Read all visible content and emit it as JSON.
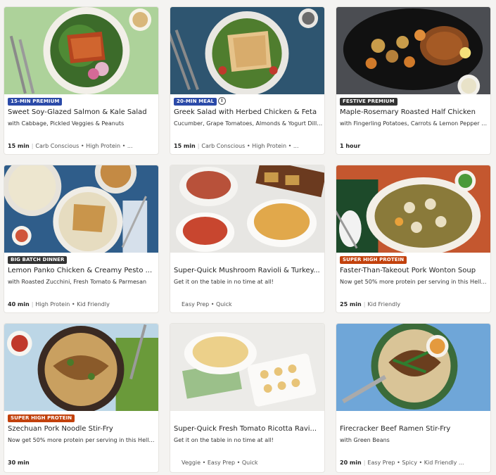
{
  "cards": [
    {
      "badge": "15-min premium",
      "badge_color": "#2b4aa8",
      "title": "Sweet Soy-Glazed Salmon & Kale Salad",
      "subtitle": "with Cabbage, Pickled Veggies & Peanuts",
      "time": "15 min",
      "tags": "Carb Conscious • High Protein • ..."
    },
    {
      "badge": "20-min meal",
      "badge_color": "#2b4aa8",
      "info_icon": "info-icon",
      "title": "Greek Salad with Herbed Chicken & Feta",
      "subtitle": "Cucumber, Grape Tomatoes, Almonds & Yogurt Dill ...",
      "time": "15 min",
      "tags": "Carb Conscious • High Protein • ..."
    },
    {
      "badge": "festive premium",
      "badge_color": "#333333",
      "title": "Maple-Rosemary Roasted Half Chicken",
      "subtitle": "with Fingerling Potatoes, Carrots & Lemon Pepper S...",
      "time": "1 hour",
      "tags": ""
    },
    {
      "badge": "big batch dinner",
      "badge_color": "#333333",
      "title": "Lemon Panko Chicken & Creamy Pesto ...",
      "subtitle": "with Roasted Zucchini, Fresh Tomato & Parmesan",
      "time": "40 min",
      "tags": "High Protein • Kid Friendly"
    },
    {
      "badge": "",
      "title": "Super-Quick Mushroom Ravioli & Turkey...",
      "subtitle": "Get it on the table in no time at all!",
      "time": "",
      "tags": "Easy Prep • Quick"
    },
    {
      "badge": "super high protein",
      "badge_color": "#c2410c",
      "title": "Faster-Than-Takeout Pork Wonton Soup",
      "subtitle": "Now get 50% more protein per serving in this HelloF...",
      "time": "25 min",
      "tags": "Kid Friendly"
    },
    {
      "badge": "super high protein",
      "badge_color": "#c2410c",
      "title": "Szechuan Pork Noodle Stir-Fry",
      "subtitle": "Now get 50% more protein per serving in this HelloF...",
      "time": "30 min",
      "tags": ""
    },
    {
      "badge": "",
      "title": "Super-Quick Fresh Tomato Ricotta Ravi...",
      "subtitle": "Get it on the table in no time at all!",
      "time": "",
      "tags": "Veggie • Easy Prep • Quick"
    },
    {
      "badge": "",
      "title": "Firecracker Beef Ramen Stir-Fry",
      "subtitle": "with Green Beans",
      "time": "20 min",
      "tags": "Easy Prep • Spicy • Kid Friendly ..."
    }
  ]
}
